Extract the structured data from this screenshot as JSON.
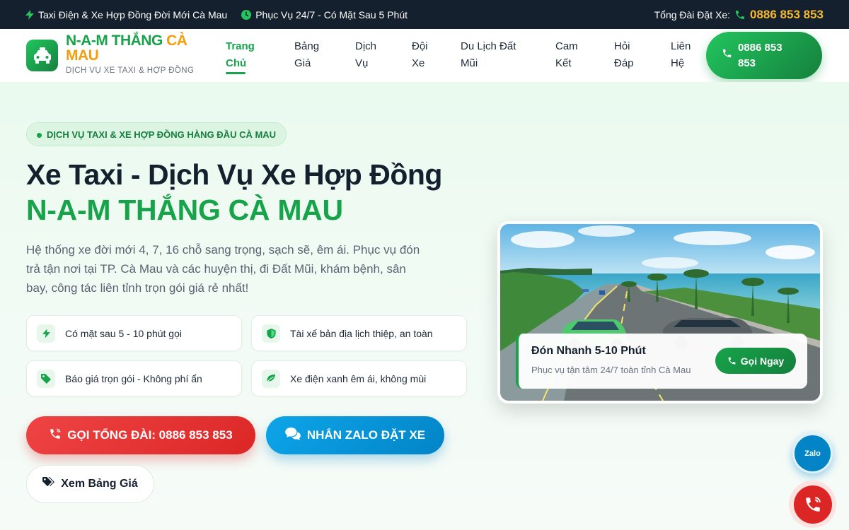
{
  "topbar": {
    "left_1": "Taxi Điện & Xe Hợp Đồng Đời Mới Cà Mau",
    "left_2": "Phục Vụ 24/7 - Có Mặt Sau 5 Phút",
    "hotline_label": "Tổng Đài Đặt Xe:",
    "hotline_number": "0886 853 853"
  },
  "header": {
    "brand_part1": "N-A-M THẮNG ",
    "brand_part2": "CÀ",
    "brand_part3": "MAU",
    "brand_sub": "DỊCH VỤ XE TAXI & HỢP ĐỒNG",
    "nav": [
      {
        "l1": "Trang",
        "l2": "Chủ"
      },
      {
        "l1": "Bảng",
        "l2": "Giá"
      },
      {
        "l1": "Dịch",
        "l2": "Vụ"
      },
      {
        "l1": "Đội",
        "l2": "Xe"
      },
      {
        "l1": "Du Lịch Đất",
        "l2": "Mũi"
      },
      {
        "l1": "Cam",
        "l2": "Kết"
      },
      {
        "l1": "Hỏi",
        "l2": "Đáp"
      },
      {
        "l1": "Liên",
        "l2": "Hệ"
      }
    ],
    "call_button": "0886 853 853"
  },
  "hero": {
    "badge": "DỊCH VỤ TAXI & XE HỢP ĐỒNG HÀNG ĐẦU CÀ MAU",
    "title_line1": "Xe Taxi - Dịch Vụ Xe Hợp Đồng",
    "title_line2": "N-A-M THẮNG CÀ MAU",
    "description": "Hệ thống xe đời mới 4, 7, 16 chỗ sang trọng, sạch sẽ, êm ái. Phục vụ đón trả tận nơi tại TP. Cà Mau và các huyện thị, đi Đất Mũi, khám bệnh, sân bay, công tác liên tỉnh trọn gói giá rẻ nhất!",
    "features": [
      {
        "text": "Có mặt sau 5 - 10 phút gọi",
        "icon": "bolt-icon"
      },
      {
        "text": "Tài xế bản địa lịch thiệp, an toàn",
        "icon": "shield-icon"
      },
      {
        "text": "Báo giá trọn gói - Không phí ẩn",
        "icon": "tag-icon"
      },
      {
        "text": "Xe điện xanh êm ái, không mùi",
        "icon": "leaf-icon"
      }
    ],
    "btn_call": "GỌI TỔNG ĐÀI: 0886 853 853",
    "btn_zalo": "NHẮN ZALO ĐẶT XE",
    "btn_price": "Xem Bảng Giá"
  },
  "photo_card": {
    "title": "Đón Nhanh 5-10 Phút",
    "subtitle": "Phục vụ tận tâm 24/7 toàn tỉnh Cà Mau",
    "button": "Gọi Ngay"
  },
  "floating": {
    "zalo_label": "Zalo"
  },
  "colors": {
    "primary_green": "#16a34a",
    "gold": "#f59e0b",
    "red": "#dc2626",
    "blue": "#0284c7",
    "dark": "#14202e"
  }
}
